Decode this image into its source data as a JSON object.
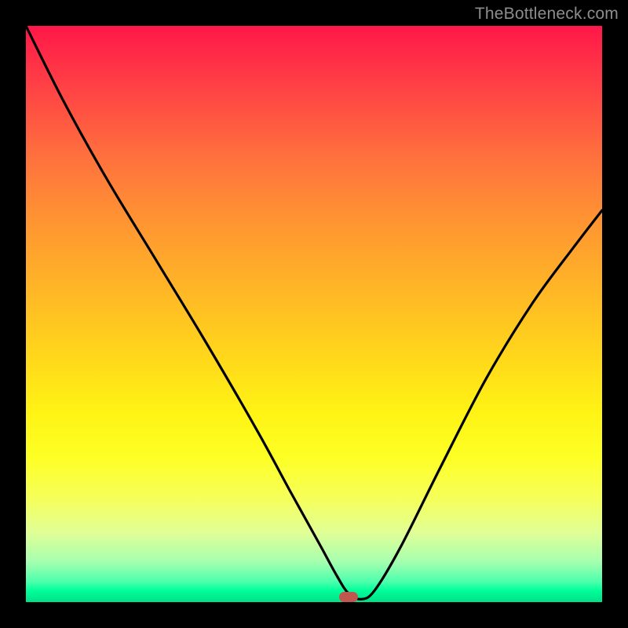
{
  "watermark": "TheBottleneck.com",
  "chart_data": {
    "type": "line",
    "title": "",
    "xlabel": "",
    "ylabel": "",
    "xlim": [
      0,
      1
    ],
    "ylim": [
      0,
      1
    ],
    "note": "Axes are unlabeled; positions are normalized fractions of the plot area. y=0 is the bottom edge; y=1 is the top edge.",
    "series": [
      {
        "name": "curve",
        "x": [
          0.0,
          0.065,
          0.14,
          0.225,
          0.31,
          0.4,
          0.46,
          0.51,
          0.54,
          0.56,
          0.582,
          0.605,
          0.65,
          0.72,
          0.8,
          0.88,
          0.95,
          1.0
        ],
        "y": [
          1.0,
          0.87,
          0.735,
          0.595,
          0.455,
          0.3,
          0.19,
          0.1,
          0.045,
          0.015,
          0.005,
          0.02,
          0.095,
          0.235,
          0.39,
          0.52,
          0.615,
          0.68
        ]
      }
    ],
    "marker": {
      "x": 0.56,
      "y": 0.006
    },
    "colors": {
      "curve": "#000000",
      "marker": "#c1564e",
      "frame": "#000000",
      "gradient_top": "#ff1749",
      "gradient_bottom": "#00e187"
    }
  }
}
